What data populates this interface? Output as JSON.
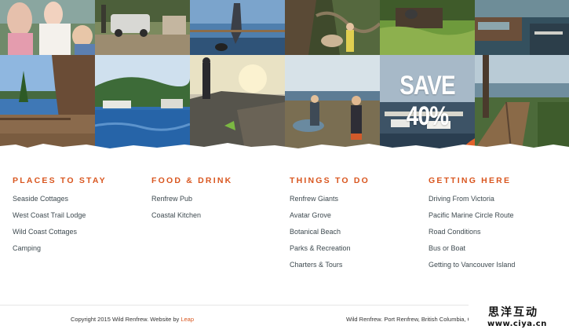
{
  "promo": {
    "text": "SAVE 40%"
  },
  "photos": [
    {
      "name": "family-photo",
      "icon": "photo"
    },
    {
      "name": "car-photo",
      "icon": "photo"
    },
    {
      "name": "yoga-photo",
      "icon": "photo"
    },
    {
      "name": "dog-forest-photo",
      "icon": "photo"
    },
    {
      "name": "cabin-grass-photo",
      "icon": "photo"
    },
    {
      "name": "deck-photo",
      "icon": "photo"
    },
    {
      "name": "lodge-waterfront-photo",
      "icon": "photo"
    },
    {
      "name": "harbour-photo",
      "icon": "photo"
    },
    {
      "name": "rock-sunset-photo",
      "icon": "photo"
    },
    {
      "name": "tidepool-kids-photo",
      "icon": "photo"
    },
    {
      "name": "promo-marina-photo",
      "icon": "photo"
    },
    {
      "name": "boardwalk-photo",
      "icon": "photo"
    }
  ],
  "footer": {
    "columns": [
      {
        "heading": "PLACES TO STAY",
        "links": [
          "Seaside Cottages",
          "West Coast Trail Lodge",
          "Wild Coast Cottages",
          "Camping"
        ]
      },
      {
        "heading": "FOOD & DRINK",
        "links": [
          "Renfrew Pub",
          "Coastal Kitchen"
        ]
      },
      {
        "heading": "THINGS TO DO",
        "links": [
          "Renfrew Giants",
          "Avatar Grove",
          "Botanical Beach",
          "Parks & Recreation",
          "Charters & Tours"
        ]
      },
      {
        "heading": "GETTING HERE",
        "links": [
          "Driving From Victoria",
          "Pacific Marine Circle Route",
          "Road Conditions",
          "Bus or Boat",
          "Getting to Vancouver Island"
        ]
      }
    ]
  },
  "bottom": {
    "copyright": "Copyright 2015 Wild Renfrew. Website by ",
    "credit_link": "Leap",
    "address": "Wild Renfrew. Port Renfrew, British Columbia, C"
  },
  "watermark": {
    "chinese": "思洋互动",
    "url": "www.ciya.cn"
  },
  "colors": {
    "accent": "#d9561f",
    "link_text": "#3e4a50",
    "divider": "#e6e6e6"
  }
}
